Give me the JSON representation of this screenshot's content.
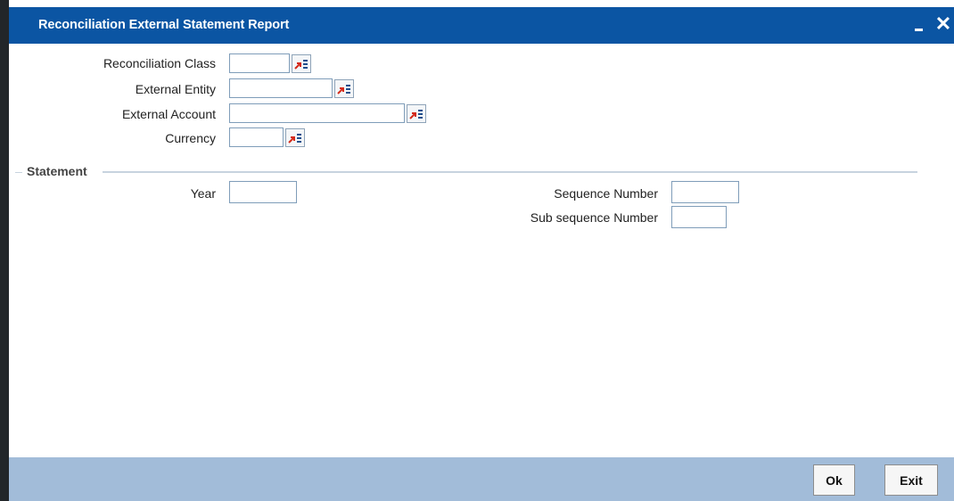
{
  "window": {
    "title": "Reconciliation External Statement Report",
    "minimize_icon": "minimize-icon",
    "close_glyph": "✕"
  },
  "fields": {
    "reconciliation_class": {
      "label": "Reconciliation Class",
      "value": ""
    },
    "external_entity": {
      "label": "External Entity",
      "value": ""
    },
    "external_account": {
      "label": "External Account",
      "value": ""
    },
    "currency": {
      "label": "Currency",
      "value": ""
    }
  },
  "statement": {
    "section_title": "Statement",
    "year": {
      "label": "Year",
      "value": ""
    },
    "sequence_number": {
      "label": "Sequence Number",
      "value": ""
    },
    "sub_sequence_number": {
      "label": "Sub sequence Number",
      "value": ""
    }
  },
  "buttons": {
    "ok": "Ok",
    "exit": "Exit"
  },
  "icons": {
    "lov": "list-of-values-icon"
  },
  "colors": {
    "titlebar": "#0b55a3",
    "footer": "#a2bcd9",
    "lov_arrow": "#d42a1a",
    "lov_lines": "#1f4e8c"
  }
}
